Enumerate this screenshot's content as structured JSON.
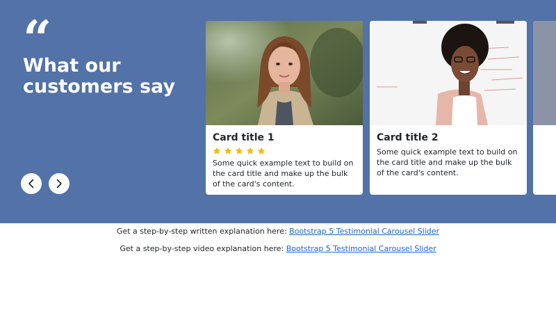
{
  "colors": {
    "brand": "#5272a8",
    "star": "#f5b800",
    "link": "#1a66c6"
  },
  "hero": {
    "quote_icon": "quote-icon",
    "quote_glyph": "“",
    "heading": "What our customers say",
    "prev_icon": "chevron-left-icon",
    "next_icon": "chevron-right-icon"
  },
  "cards": [
    {
      "title": "Card title 1",
      "rating": 5,
      "text": "Some quick example text to build on the card title and make up the bulk of the card's content."
    },
    {
      "title": "Card title 2",
      "text": "Some quick example text to build on the card title and make up the bulk of the card's content."
    }
  ],
  "footer": {
    "written_prefix": "Get a step-by-step written explanation here: ",
    "written_link": "Bootstrap 5 Testimonial Carousel Slider",
    "video_prefix": "Get a step-by-step video explanation here: ",
    "video_link": "Bootstrap 5 Testimonial Carousel Slider"
  }
}
